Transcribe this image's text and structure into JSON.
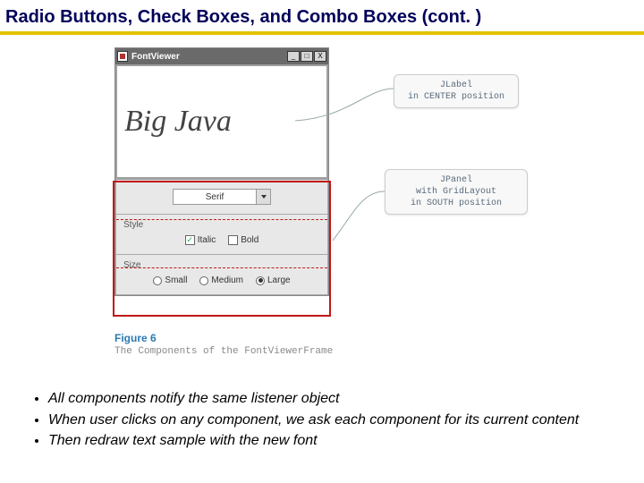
{
  "title": "Radio Buttons, Check Boxes, and Combo Boxes  (cont. )",
  "window": {
    "title": "FontViewer",
    "sample_text": "Big Java",
    "combo": {
      "selected": "Serif"
    },
    "style": {
      "label": "Style",
      "italic": {
        "label": "Italic",
        "checked": true
      },
      "bold": {
        "label": "Bold",
        "checked": false
      }
    },
    "size": {
      "label": "Size",
      "small": {
        "label": "Small",
        "selected": false
      },
      "medium": {
        "label": "Medium",
        "selected": false
      },
      "large": {
        "label": "Large",
        "selected": true
      }
    }
  },
  "callouts": {
    "label": {
      "line1": "JLabel",
      "line2": "in CENTER position"
    },
    "panel": {
      "line1": "JPanel",
      "line2": "with GridLayout",
      "line3": "in SOUTH position"
    }
  },
  "figure": {
    "number": "Figure 6",
    "caption": "The Components of the FontViewerFrame"
  },
  "bullets": [
    "All components notify the same listener object",
    "When user clicks on any component, we ask each component for its current content",
    "Then redraw text sample with the new font"
  ]
}
